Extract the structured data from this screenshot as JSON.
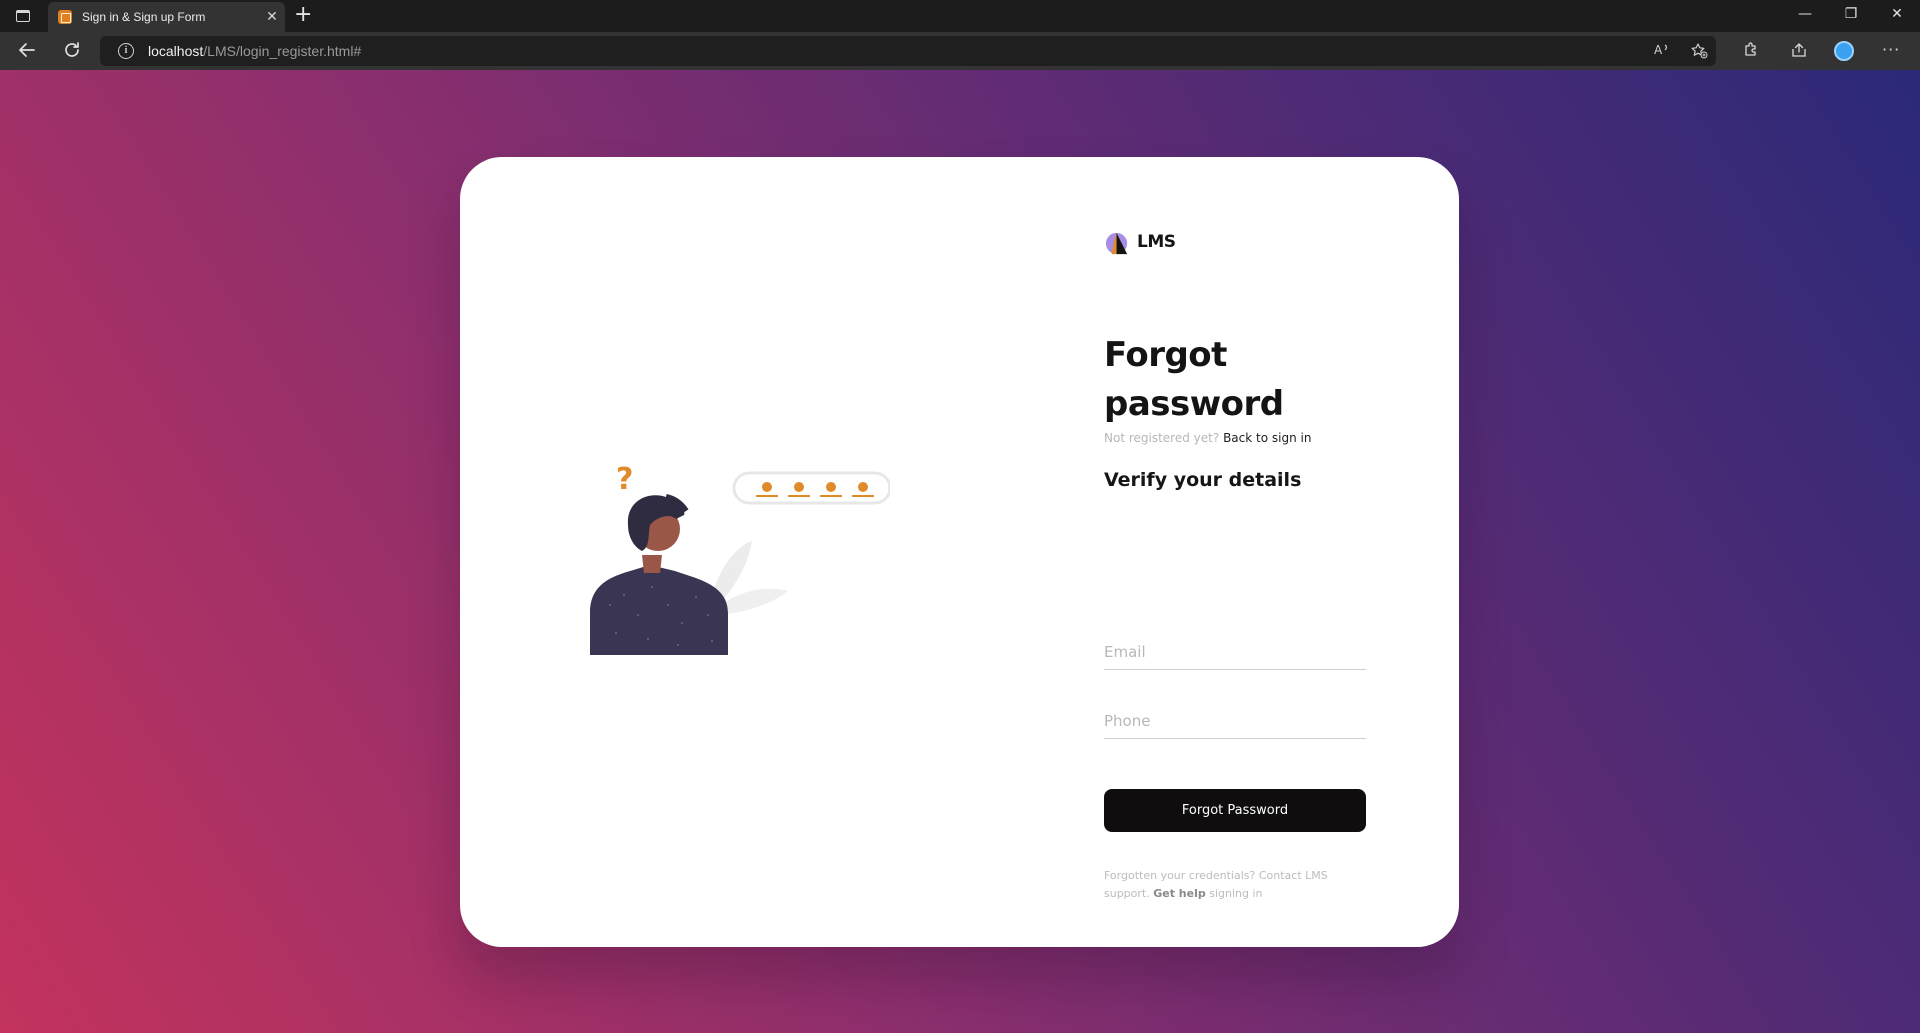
{
  "browser": {
    "tab_title": "Sign in & Sign up Form",
    "tab_close": "✕",
    "new_tab": "+",
    "url_host": "localhost",
    "url_path": "/LMS/login_register.html#",
    "window_controls": {
      "minimize": "—",
      "restore": "❐",
      "close": "✕"
    },
    "icons": [
      "tab-actions-icon",
      "back-icon",
      "reload-icon",
      "info-icon",
      "read-aloud-icon",
      "favorites-icon",
      "extensions-icon",
      "share-icon",
      "profile-icon",
      "more-icon"
    ]
  },
  "page": {
    "background_colors": [
      "#c3335d",
      "#8f2f6d",
      "#5e2b74",
      "#2b2a78"
    ],
    "brand_name": "LMS",
    "heading_line1": "Forgot",
    "heading_line2": "password",
    "not_registered": "Not registered yet?",
    "back_to_sign_in": "Back to sign in",
    "verify_heading": "Verify your details",
    "email_placeholder": "Email",
    "phone_placeholder": "Phone",
    "submit_label": "Forgot Password",
    "help_prefix": "Forgotten your credentials? Contact LMS support.",
    "help_link": "Get help",
    "help_suffix": "signing in",
    "accent_color": "#e08a2a",
    "button_color": "#0f0d0d"
  }
}
